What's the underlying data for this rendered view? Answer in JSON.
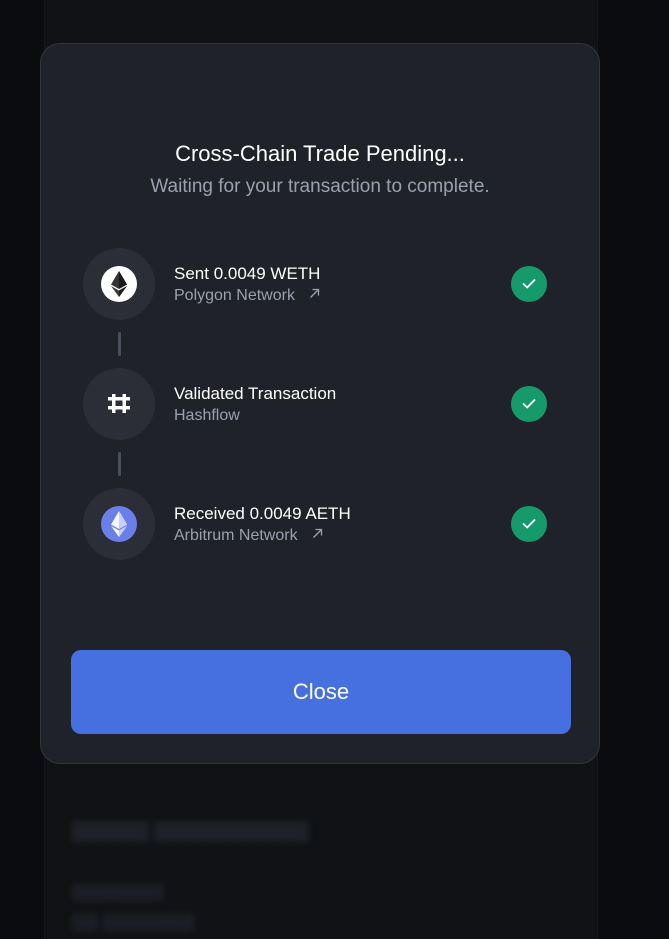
{
  "modal": {
    "title": "Cross-Chain Trade Pending...",
    "subtitle": "Waiting for your transaction to complete."
  },
  "steps": [
    {
      "title": "Sent 0.0049 WETH",
      "subtitle": "Polygon Network",
      "icon": "ethereum-icon",
      "has_external_link": true,
      "status": "complete"
    },
    {
      "title": "Validated Transaction",
      "subtitle": "Hashflow",
      "icon": "hashflow-icon",
      "has_external_link": false,
      "status": "complete"
    },
    {
      "title": "Received 0.0049 AETH",
      "subtitle": "Arbitrum Network",
      "icon": "ethereum-icon",
      "has_external_link": true,
      "status": "complete"
    }
  ],
  "close_button": {
    "label": "Close"
  },
  "colors": {
    "modal_bg": "#1f2229",
    "accent": "#4670e0",
    "success": "#179a6b",
    "muted_text": "#9aa1ad"
  }
}
